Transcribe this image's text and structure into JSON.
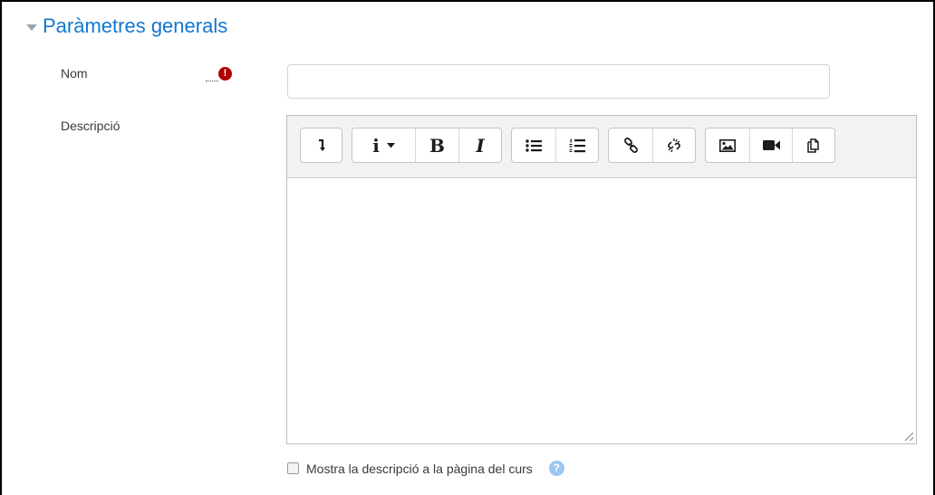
{
  "section": {
    "title": "Paràmetres generals",
    "icon": "collapse-triangle-icon"
  },
  "fields": {
    "name": {
      "label": "Nom",
      "value": "",
      "placeholder": "",
      "required_icon": "exclamation-circle-icon",
      "required_icon_text": "!"
    },
    "description": {
      "label": "Descripció",
      "value": ""
    }
  },
  "toolbar": {
    "groups": [
      [
        "collapse-icon"
      ],
      [
        "paragraph-styles-icon",
        "bold-icon",
        "italic-icon"
      ],
      [
        "unordered-list-icon",
        "ordered-list-icon"
      ],
      [
        "link-icon",
        "unlink-icon"
      ],
      [
        "image-icon",
        "video-icon",
        "manage-files-icon"
      ]
    ],
    "style_glyph": "i",
    "bold_glyph": "B",
    "italic_glyph": "I"
  },
  "show_description": {
    "label": "Mostra la descripció a la pàgina del curs",
    "checked": false,
    "help_icon": "question-circle-icon",
    "help_text": "?"
  },
  "colors": {
    "accent": "#1177d1",
    "required": "#b00000",
    "help": "#9bc7ee"
  }
}
